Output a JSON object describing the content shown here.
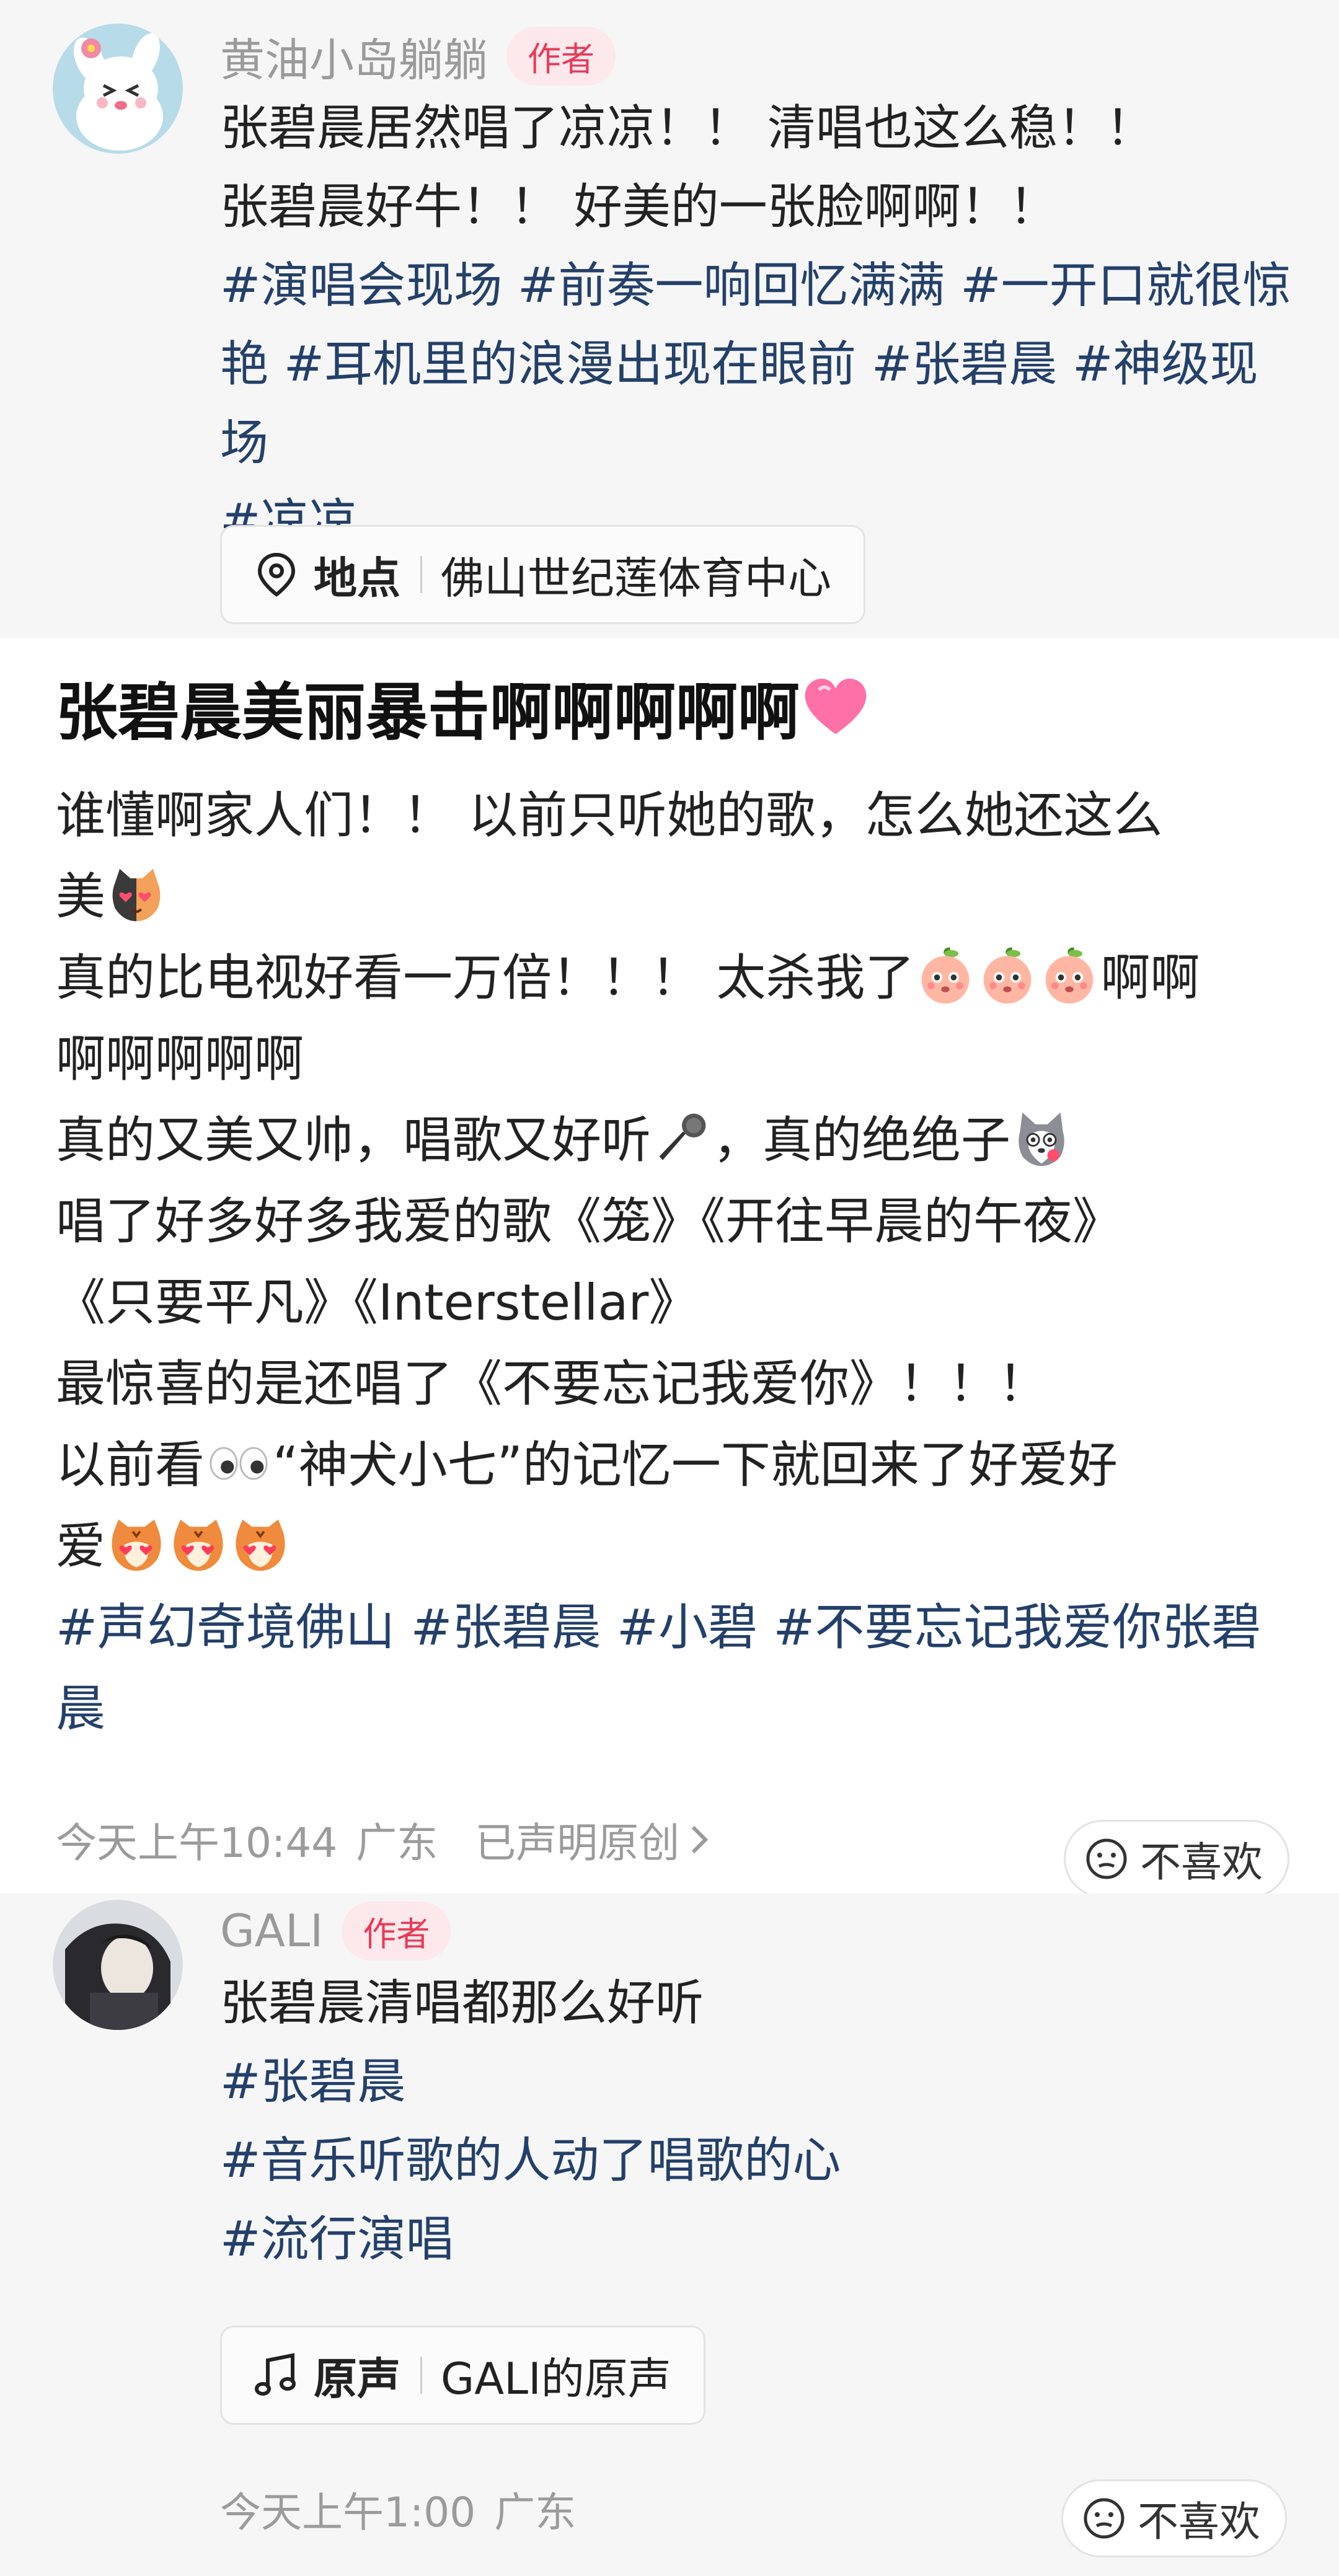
{
  "comment1": {
    "author": "黄油小岛躺躺",
    "badge": "作者",
    "lines": [
      "张碧晨居然唱了凉凉！！ 清唱也这么稳！！",
      "张碧晨好牛！！ 好美的一张脸啊啊！！"
    ],
    "tag_lines": [
      "#演唱会现场 #前奏一响回忆满满 #一开口就很惊",
      "艳 #耳机里的浪漫出现在眼前 #张碧晨 #神级现场",
      "#凉凉"
    ],
    "chip": {
      "icon": "location-pin-icon",
      "label": "地点",
      "value": "佛山世纪莲体育中心"
    }
  },
  "post": {
    "title": "张碧晨美丽暴击啊啊啊啊啊",
    "title_emoji": "pink-heart-icon",
    "lines": {
      "l1": "谁懂啊家人们！！ 以前只听她的歌，怎么她还这么",
      "l2": "美",
      "l3a": "真的比电视好看一万倍！！！ 太杀我了",
      "l3b": "啊啊",
      "l4": "啊啊啊啊啊",
      "l5a": "真的又美又帅，唱歌又好听",
      "l5b": "，真的绝绝子",
      "l6": "唱了好多好多我爱的歌《笼》《开往早晨的午夜》",
      "l7": "《只要平凡》《Interstellar》",
      "l8": "最惊喜的是还唱了《不要忘记我爱你》！！！",
      "l9a": "以前看",
      "l9b": "“神犬小七”的记忆一下就回来了好爱好",
      "l10": "爱"
    },
    "tags": [
      "#声幻奇境佛山 #张碧晨 #小碧 #不要忘记我爱你张碧",
      "晨"
    ],
    "meta": {
      "time": "今天上午10:44",
      "location": "广东",
      "original": "已声明原创"
    },
    "dislike": "不喜欢"
  },
  "comment2": {
    "author": "GALI",
    "badge": "作者",
    "text": "张碧晨清唱都那么好听",
    "tags": [
      "#张碧晨",
      "#音乐听歌的人动了唱歌的心",
      "#流行演唱"
    ],
    "chip": {
      "icon": "music-note-icon",
      "label": "原声",
      "value": "GALI的原声"
    },
    "meta": {
      "time": "今天上午1:00",
      "location": "广东"
    },
    "dislike": "不喜欢"
  },
  "colors": {
    "tag": "#24406a",
    "badge_text": "#e63b57",
    "badge_bg": "#fde8ec",
    "meta": "#9b9b9b"
  }
}
